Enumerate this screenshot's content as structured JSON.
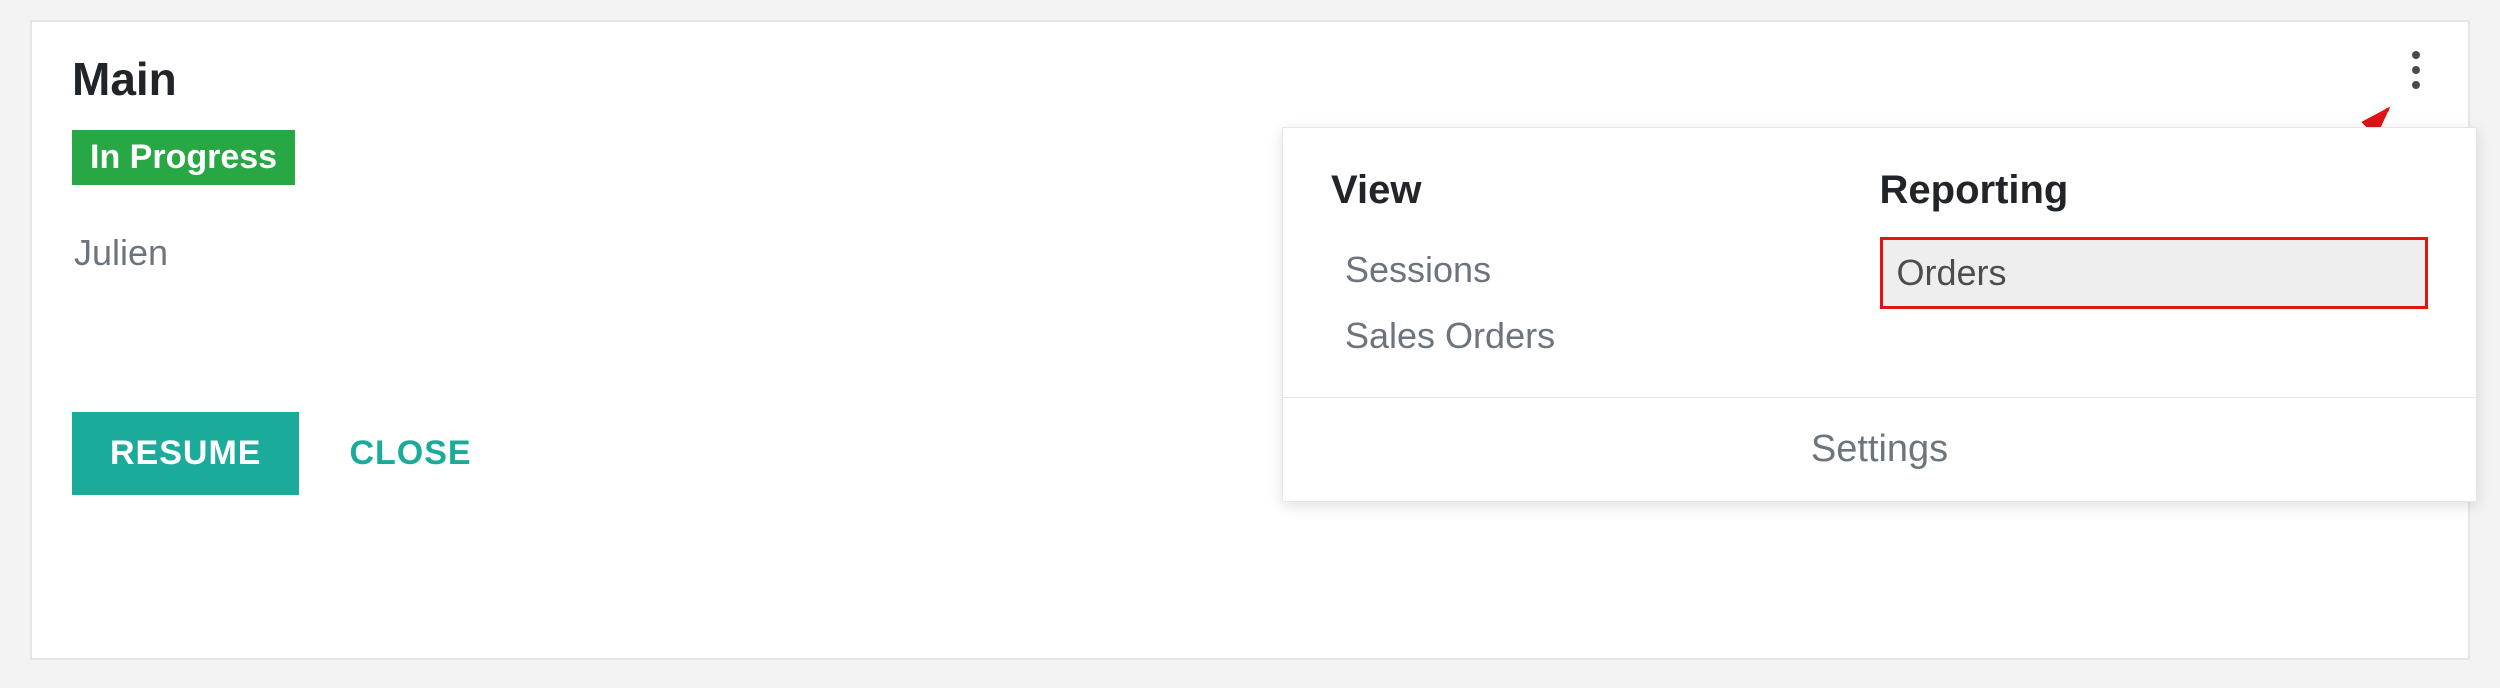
{
  "card": {
    "title": "Main",
    "status": "In Progress",
    "user": "Julien",
    "resume_label": "Resume",
    "close_label": "Close"
  },
  "dropdown": {
    "view": {
      "heading": "View",
      "sessions": "Sessions",
      "sales_orders": "Sales Orders"
    },
    "reporting": {
      "heading": "Reporting",
      "orders": "Orders"
    },
    "footer": {
      "settings": "Settings"
    }
  }
}
